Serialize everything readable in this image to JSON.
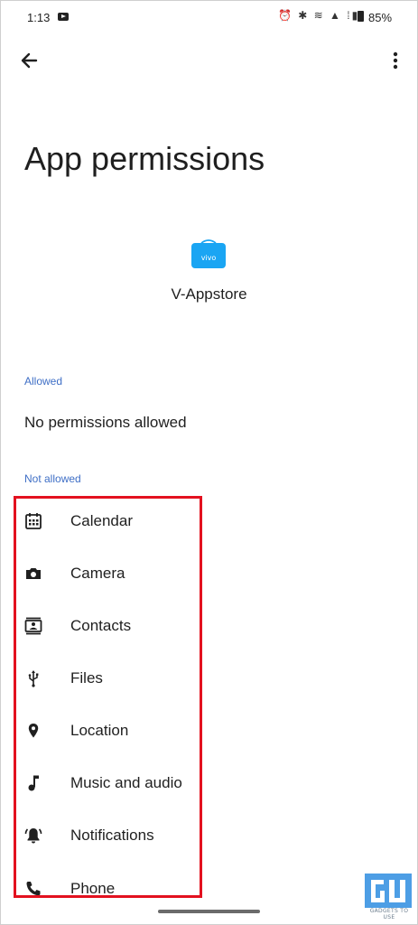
{
  "status_bar": {
    "time": "1:13",
    "icons_text": "⏰ ✱ ≋ ▲ ⁞▮",
    "battery": "85%"
  },
  "icons": {
    "back": "back-arrow-icon",
    "more": "more-vert-icon",
    "app": "v-appstore-icon"
  },
  "colors": {
    "accent": "#3f6fc6",
    "highlight": "#e3111f",
    "app_icon": "#1aa5f3"
  },
  "header": {
    "title": "App permissions"
  },
  "app": {
    "name": "V-Appstore",
    "icon_text": "vivo"
  },
  "sections": {
    "allowed_label": "Allowed",
    "allowed_empty": "No permissions allowed",
    "not_allowed_label": "Not allowed"
  },
  "permissions": [
    {
      "label": "Calendar",
      "icon": "calendar-icon"
    },
    {
      "label": "Camera",
      "icon": "camera-icon"
    },
    {
      "label": "Contacts",
      "icon": "contacts-icon"
    },
    {
      "label": "Files",
      "icon": "usb-icon"
    },
    {
      "label": "Location",
      "icon": "location-pin-icon"
    },
    {
      "label": "Music and audio",
      "icon": "music-note-icon"
    },
    {
      "label": "Notifications",
      "icon": "bell-icon"
    },
    {
      "label": "Phone",
      "icon": "phone-icon"
    }
  ],
  "watermark": {
    "text": "GADGETS TO USE"
  }
}
